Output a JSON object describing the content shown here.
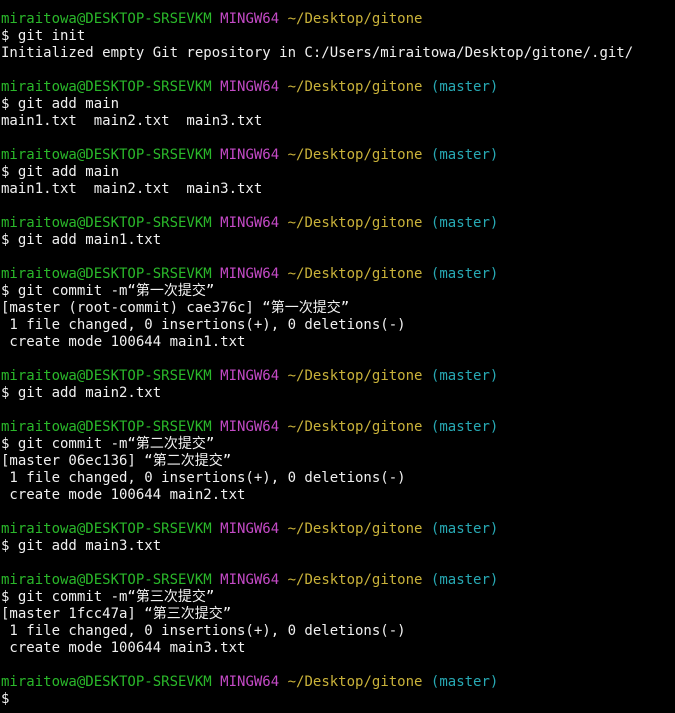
{
  "terminal": {
    "colors": {
      "background": "#000000",
      "text": "#f0f0f0",
      "user_host": "#2ab82a",
      "system": "#c44ac6",
      "path": "#c9b23a",
      "branch": "#27a9b4"
    },
    "lines": [
      {
        "type": "prompt",
        "user_host": "miraitowa@DESKTOP-SRSEVKM",
        "system": "MINGW64",
        "path": "~/Desktop/gitone",
        "branch": ""
      },
      {
        "type": "text",
        "text": "$ git init"
      },
      {
        "type": "text",
        "text": "Initialized empty Git repository in C:/Users/miraitowa/Desktop/gitone/.git/"
      },
      {
        "type": "blank"
      },
      {
        "type": "prompt",
        "user_host": "miraitowa@DESKTOP-SRSEVKM",
        "system": "MINGW64",
        "path": "~/Desktop/gitone",
        "branch": "(master)"
      },
      {
        "type": "text",
        "text": "$ git add main"
      },
      {
        "type": "text",
        "text": "main1.txt  main2.txt  main3.txt"
      },
      {
        "type": "blank"
      },
      {
        "type": "prompt",
        "user_host": "miraitowa@DESKTOP-SRSEVKM",
        "system": "MINGW64",
        "path": "~/Desktop/gitone",
        "branch": "(master)"
      },
      {
        "type": "text",
        "text": "$ git add main"
      },
      {
        "type": "text",
        "text": "main1.txt  main2.txt  main3.txt"
      },
      {
        "type": "blank"
      },
      {
        "type": "prompt",
        "user_host": "miraitowa@DESKTOP-SRSEVKM",
        "system": "MINGW64",
        "path": "~/Desktop/gitone",
        "branch": "(master)"
      },
      {
        "type": "text",
        "text": "$ git add main1.txt"
      },
      {
        "type": "blank"
      },
      {
        "type": "prompt",
        "user_host": "miraitowa@DESKTOP-SRSEVKM",
        "system": "MINGW64",
        "path": "~/Desktop/gitone",
        "branch": "(master)"
      },
      {
        "type": "text",
        "text": "$ git commit -m“第一次提交”"
      },
      {
        "type": "text",
        "text": "[master (root-commit) cae376c] “第一次提交”"
      },
      {
        "type": "text",
        "text": " 1 file changed, 0 insertions(+), 0 deletions(-)"
      },
      {
        "type": "text",
        "text": " create mode 100644 main1.txt"
      },
      {
        "type": "blank"
      },
      {
        "type": "prompt",
        "user_host": "miraitowa@DESKTOP-SRSEVKM",
        "system": "MINGW64",
        "path": "~/Desktop/gitone",
        "branch": "(master)"
      },
      {
        "type": "text",
        "text": "$ git add main2.txt"
      },
      {
        "type": "blank"
      },
      {
        "type": "prompt",
        "user_host": "miraitowa@DESKTOP-SRSEVKM",
        "system": "MINGW64",
        "path": "~/Desktop/gitone",
        "branch": "(master)"
      },
      {
        "type": "text",
        "text": "$ git commit -m“第二次提交”"
      },
      {
        "type": "text",
        "text": "[master 06ec136] “第二次提交”"
      },
      {
        "type": "text",
        "text": " 1 file changed, 0 insertions(+), 0 deletions(-)"
      },
      {
        "type": "text",
        "text": " create mode 100644 main2.txt"
      },
      {
        "type": "blank"
      },
      {
        "type": "prompt",
        "user_host": "miraitowa@DESKTOP-SRSEVKM",
        "system": "MINGW64",
        "path": "~/Desktop/gitone",
        "branch": "(master)"
      },
      {
        "type": "text",
        "text": "$ git add main3.txt"
      },
      {
        "type": "blank"
      },
      {
        "type": "prompt",
        "user_host": "miraitowa@DESKTOP-SRSEVKM",
        "system": "MINGW64",
        "path": "~/Desktop/gitone",
        "branch": "(master)"
      },
      {
        "type": "text",
        "text": "$ git commit -m“第三次提交”"
      },
      {
        "type": "text",
        "text": "[master 1fcc47a] “第三次提交”"
      },
      {
        "type": "text",
        "text": " 1 file changed, 0 insertions(+), 0 deletions(-)"
      },
      {
        "type": "text",
        "text": " create mode 100644 main3.txt"
      },
      {
        "type": "blank"
      },
      {
        "type": "prompt",
        "user_host": "miraitowa@DESKTOP-SRSEVKM",
        "system": "MINGW64",
        "path": "~/Desktop/gitone",
        "branch": "(master)"
      },
      {
        "type": "text",
        "text": "$"
      }
    ]
  }
}
